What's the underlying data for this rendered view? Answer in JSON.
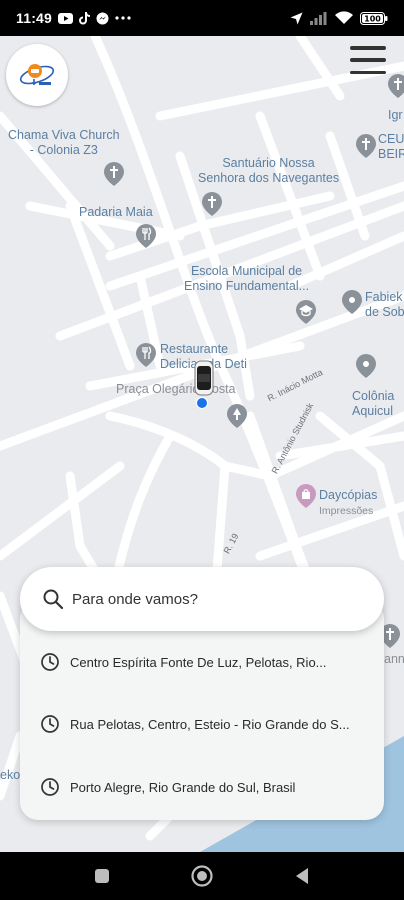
{
  "status_bar": {
    "time": "11:49",
    "left_icons": [
      "youtube-icon",
      "tiktok-icon",
      "messenger-icon",
      "more-dots-icon"
    ],
    "right_icons": [
      "location-arrow-icon",
      "signal-icon",
      "wifi-icon",
      "battery-icon"
    ],
    "battery": "100"
  },
  "map": {
    "places": {
      "church": "Chama Viva Church\n- Colonia Z3",
      "santuario": "Santuário Nossa\nSenhora dos Navegantes",
      "padaria": "Padaria Maia",
      "escola": "Escola Municipal de\nEnsino Fundamental...",
      "restaurante": "Restaurante\nDelicias da Deti",
      "praca": "Praça Olegário Costa",
      "daycopias": "Daycópias",
      "daycopias_sub": "Impressões",
      "ig": "Igr",
      "ceu": "CEU\nBEIR",
      "fabiek": "Fabiek\nde Sob",
      "colonia": "Colônia\nAquicul",
      "left_edge": "eko",
      "right_edge": "ann"
    },
    "streets": {
      "inacio": "R. Inácio Motta",
      "antonio": "R. Antônio Studnisk",
      "r19": "R. 19"
    }
  },
  "logo_icon": "app-logo-icon",
  "menu_icon": "hamburger-menu-icon",
  "search": {
    "placeholder": "Para onde vamos?"
  },
  "recent_destinations": [
    "Centro Espírita Fonte De Luz, Pelotas, Rio...",
    "Rua Pelotas, Centro, Esteio - Rio Grande do S...",
    "Porto Alegre, Rio Grande do Sul, Brasil"
  ],
  "nav_bar": {
    "icons": [
      "recents-square-icon",
      "home-circle-icon",
      "back-triangle-icon"
    ]
  },
  "colors": {
    "map_background": "#e9ebee",
    "road": "#ffffff",
    "water": "#9fc4e0",
    "poi_label": "#5c7fa0",
    "location_dot": "#1a73e8",
    "panel": "#f4f5f5"
  }
}
